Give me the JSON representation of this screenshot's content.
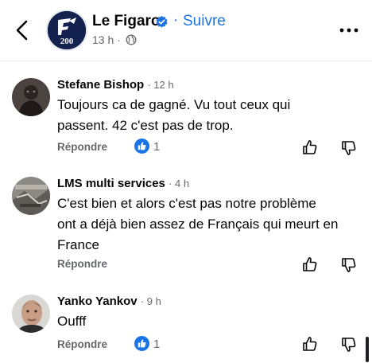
{
  "header": {
    "page_name": "Le Figaro",
    "follow_label": "Suivre",
    "separator": "·",
    "time": "13 h ·",
    "logo_text": "200",
    "logo_letter": "F"
  },
  "comments": [
    {
      "author": "Stefane Bishop",
      "time": "· 12 h",
      "lines": [
        "Toujours ca de gagné. Vu tout ceux qui",
        "passent. 42 c'est pas de trop."
      ],
      "reply_label": "Répondre",
      "like_count": "1"
    },
    {
      "author": "LMS multi services",
      "time": "· 4 h",
      "lines": [
        "C'est bien et alors c'est pas notre problème",
        "ont a déjà bien assez de Français qui meurt en",
        "France"
      ],
      "reply_label": "Répondre"
    },
    {
      "author": "Yanko Yankov",
      "time": "· 9 h",
      "lines": [
        "Oufff"
      ],
      "reply_label": "Répondre",
      "like_count": "1"
    }
  ],
  "icons": {
    "back": "chevron-left-icon",
    "verified": "verified-badge-icon",
    "globe": "globe-icon",
    "more": "more-horizontal-icon",
    "like_reaction": "like-reaction-icon",
    "upvote": "thumbs-up-outline-icon",
    "downvote": "thumbs-down-outline-icon"
  },
  "colors": {
    "accent": "#1b74e4",
    "muted": "#65676b",
    "text": "#050505",
    "logo_bg": "#13214f"
  }
}
